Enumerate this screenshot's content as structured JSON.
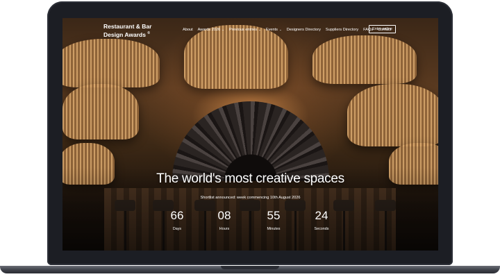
{
  "header": {
    "logo_line1": "Restaurant & Bar",
    "logo_line2": "Design Awards",
    "logo_mark": "®",
    "nav": [
      {
        "label": "About",
        "dropdown": false
      },
      {
        "label": "Awards 2026",
        "dropdown": true
      },
      {
        "label": "Previous entries",
        "dropdown": true
      },
      {
        "label": "Events",
        "dropdown": true
      },
      {
        "label": "Designers Directory",
        "dropdown": false
      },
      {
        "label": "Suppliers Directory",
        "dropdown": false
      },
      {
        "label": "FAQs",
        "dropdown": false
      },
      {
        "label": "Contact",
        "dropdown": false
      }
    ],
    "caret_icon": "chevron-down-icon",
    "enter_button": "Enter online"
  },
  "hero": {
    "title": "The world's most creative spaces",
    "subtitle": "Shortlist announced: week commencing 10th August 2026"
  },
  "countdown": [
    {
      "value": "66",
      "label": "Days"
    },
    {
      "value": "08",
      "label": "Hours"
    },
    {
      "value": "55",
      "label": "Minutes"
    },
    {
      "value": "24",
      "label": "Seconds"
    }
  ],
  "colors": {
    "text": "#ffffff",
    "laptop_frame": "#1c1e24",
    "warm_glow": "#ffaf5f"
  }
}
